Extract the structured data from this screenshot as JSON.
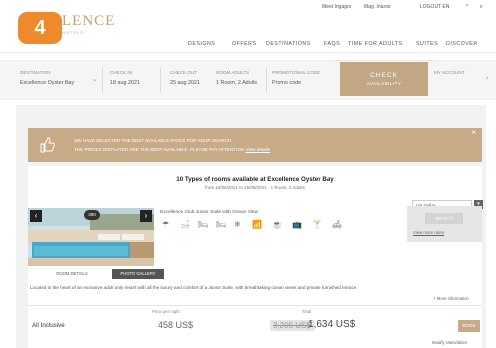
{
  "step_badge": "4",
  "topbar": {
    "items": [
      "Meet Ingagro",
      "Mag. Inaros",
      "LOGOUT EN",
      "^",
      "v"
    ]
  },
  "logo": {
    "text": "LENCE",
    "sub": "HOTELS"
  },
  "nav": {
    "items": [
      "DESIGNS",
      "OFFERS",
      "DESTINATIONS",
      "FAQS",
      "TIME FOR ADULTS",
      "SUITES",
      "DISCOVER"
    ]
  },
  "search": {
    "fields": [
      {
        "label": "DESTINATION",
        "value": "Excellence Oyster Bay"
      },
      {
        "label": "CHECK IN",
        "value": "18 aug 2021"
      },
      {
        "label": "CHECK OUT",
        "value": "25 aug 2021"
      },
      {
        "label": "ROOM ADULTS",
        "value": "1 Room, 2 Adults"
      },
      {
        "label": "PROMOTIONAL CODE",
        "value": "Promo code"
      },
      {
        "label": "MY ACCOUNT",
        "value": ""
      }
    ],
    "button_title": "CHECK",
    "button_sub": "AVAILABILITY"
  },
  "banner": {
    "line1": "WE HAVE SELECTED THE BEST AVAILABLE RATES FOR YOUR SEARCH",
    "line2": "THE PRICES DISPLAYED ARE THE BEST AVAILABLE. PLEASE PAY ATTENTION",
    "link": "View details",
    "close": "×"
  },
  "rooms": {
    "title": "10 Types of rooms available at Excellence Oyster Bay",
    "subtitle": "from 18/08/2021 to 25/08/2021 - 1 Room, 2 Adults",
    "currency": "US Dollar",
    "currency_arrow": "▾"
  },
  "room": {
    "title": "Excellence Club Junior Suite with Ocean View",
    "photo_badge": "360",
    "prev": "‹",
    "next": "›",
    "amenities": [
      "☂",
      "🛁",
      "🛏",
      "🛏",
      "❄",
      "📶",
      "☕",
      "📺",
      "🍸",
      "🛋"
    ],
    "select_label": "SELECT",
    "more_rates": "View more rates",
    "pill_details": "ROOM DETAILS",
    "pill_photos": "PHOTO GALLERY",
    "description": "Located in the heart of an exclusive adult only resort with all the luxury and comfort of a Junior Suite, with breathtaking ocean views and private furnished terrace.",
    "more_info": "+ More information",
    "col_night": "Price per night",
    "col_total": "Total",
    "rate_name": "All Inclusive",
    "price_night": "458 US$",
    "price_old": "3,205 US$",
    "price_total": "1,634 US$",
    "book_label": "BOOK",
    "rates_link": "Modify rates/dates"
  },
  "colors": {
    "accent": "#c6ab86",
    "badge": "#ef8a2c"
  }
}
